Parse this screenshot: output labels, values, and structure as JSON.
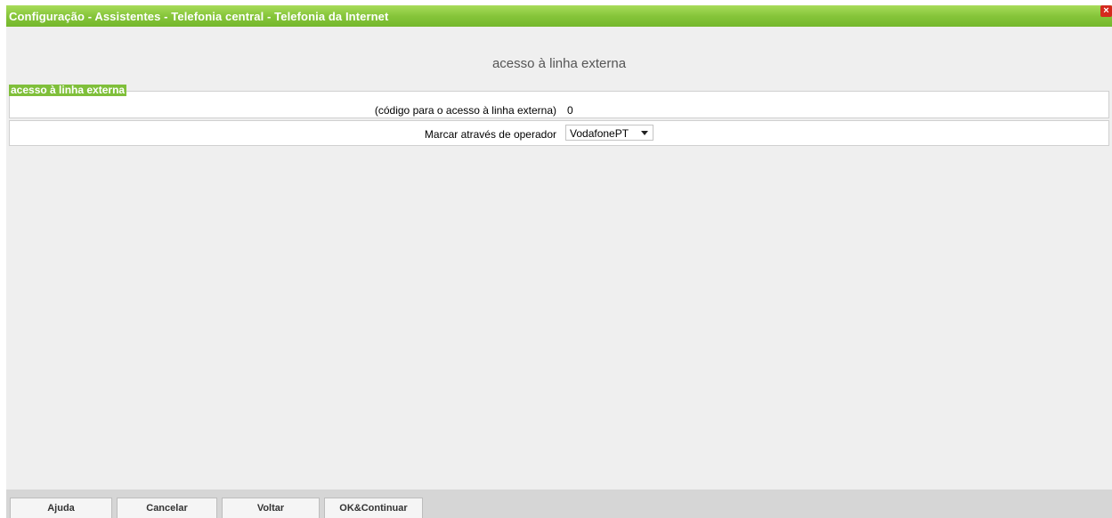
{
  "window": {
    "title": "Configuração - Assistentes - Telefonia central - Telefonia da Internet",
    "close_icon": "×"
  },
  "page": {
    "heading": "acesso à linha externa"
  },
  "section": {
    "title": "acesso à linha externa",
    "rows": [
      {
        "label": "(código para o acesso à linha externa)",
        "value": "0"
      },
      {
        "label": "Marcar através de operador",
        "selected": "VodafonePT"
      }
    ]
  },
  "footer": {
    "help": "Ajuda",
    "cancel": "Cancelar",
    "back": "Voltar",
    "ok_continue": "OK&Continuar"
  },
  "colors": {
    "titlebar": "#86c53a",
    "section_tag": "#7fbf3a",
    "close": "#d42a1e",
    "background": "#efefef",
    "footer": "#d6d6d6"
  }
}
